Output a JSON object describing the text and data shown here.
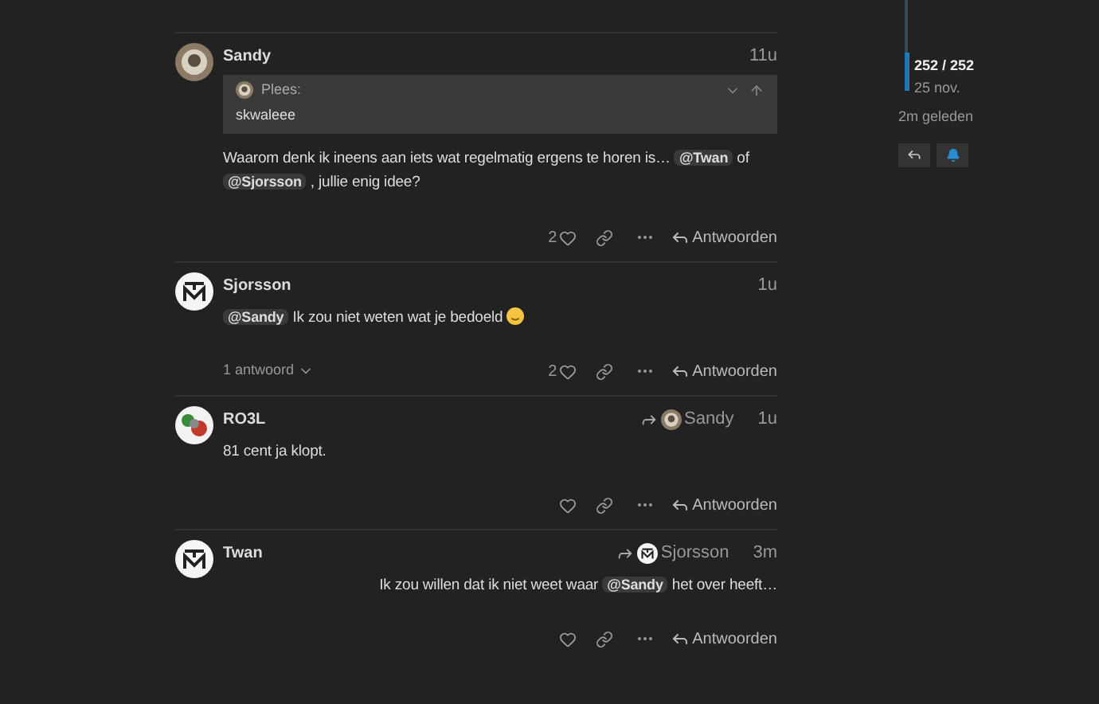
{
  "posts": [
    {
      "author": "Sandy",
      "avatar": {
        "kind": "sketch"
      },
      "time": "11u",
      "quote": {
        "author": "Plees:",
        "text": "skwaleee"
      },
      "body": [
        {
          "kind": "text",
          "text": "Waarom denk ik ineens aan iets wat regelmatig ergens te horen is… "
        },
        {
          "kind": "mention",
          "text": "@Twan"
        },
        {
          "kind": "text",
          "text": " of "
        },
        {
          "kind": "mention",
          "text": "@Sjorsson"
        },
        {
          "kind": "text",
          "text": " , jullie enig idee?"
        }
      ],
      "right_aligned": false,
      "like_count": "2",
      "reply_label": "Antwoorden"
    },
    {
      "author": "Sjorsson",
      "avatar": {
        "kind": "logo"
      },
      "time": "1u",
      "body": [
        {
          "kind": "mention",
          "text": "@Sandy"
        },
        {
          "kind": "text",
          "text": " Ik zou niet weten wat je bedoeld "
        },
        {
          "kind": "emoji"
        }
      ],
      "right_aligned": false,
      "replies": "1 antwoord",
      "like_count": "2",
      "reply_label": "Antwoorden"
    },
    {
      "author": "RO3L",
      "avatar": {
        "kind": "colorful"
      },
      "time": "1u",
      "reply_to": {
        "name": "Sandy",
        "avatar": {
          "kind": "sketch"
        }
      },
      "body": [
        {
          "kind": "text",
          "text": "81 cent ja klopt."
        }
      ],
      "right_aligned": false,
      "reply_label": "Antwoorden"
    },
    {
      "author": "Twan",
      "avatar": {
        "kind": "logo"
      },
      "time": "3m",
      "reply_to": {
        "name": "Sjorsson",
        "avatar": {
          "kind": "logo"
        }
      },
      "body": [
        {
          "kind": "text",
          "text": "Ik zou willen dat ik niet weet waar "
        },
        {
          "kind": "mention",
          "text": "@Sandy"
        },
        {
          "kind": "text",
          "text": " het over heeft…"
        }
      ],
      "right_aligned": true,
      "reply_label": "Antwoorden"
    }
  ],
  "timeline": {
    "position": "252 / 252",
    "date": "25 nov.",
    "level": 1,
    "ago": "2m geleden"
  }
}
